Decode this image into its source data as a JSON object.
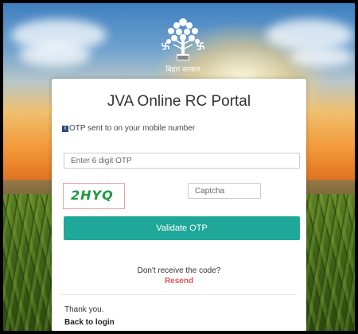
{
  "header": {
    "emblem_caption": "बिहार सरकार"
  },
  "card": {
    "title": "JVA Online RC Portal",
    "info_icon": "info-icon",
    "info_text": "OTP sent to on your mobile number",
    "otp_placeholder": "Enter 6 digit OTP",
    "captcha_text": "2HYQ",
    "captcha_placeholder": "Captcha",
    "validate_label": "Validate OTP",
    "no_code_text": "Don't receive the code?",
    "resend_label": "Resend",
    "thanks_text": "Thank you.",
    "back_label": "Back to login"
  },
  "colors": {
    "button": "#1fa89a",
    "resend": "#e05555",
    "captcha": "#1d9a3b"
  }
}
